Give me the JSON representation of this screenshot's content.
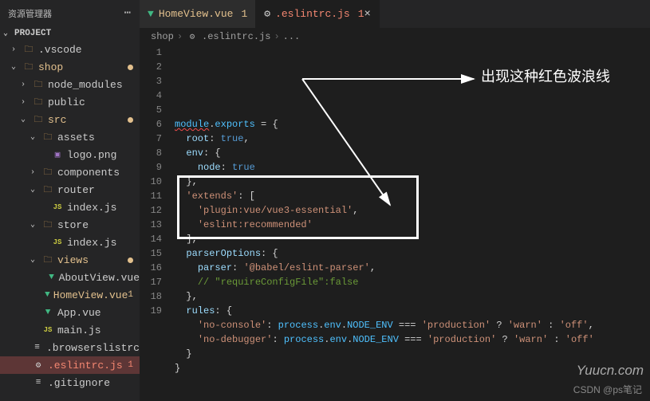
{
  "sidebar": {
    "title": "资源管理器",
    "project": "PROJECT",
    "items": [
      {
        "label": ".vscode",
        "type": "folder",
        "indent": 1,
        "chev": "›"
      },
      {
        "label": "shop",
        "type": "folder",
        "indent": 1,
        "chev": "⌄",
        "modified": true,
        "dot": true
      },
      {
        "label": "node_modules",
        "type": "folder",
        "indent": 2,
        "chev": "›"
      },
      {
        "label": "public",
        "type": "folder",
        "indent": 2,
        "chev": "›"
      },
      {
        "label": "src",
        "type": "folder",
        "indent": 2,
        "chev": "⌄",
        "modified": true,
        "dot": true
      },
      {
        "label": "assets",
        "type": "folder",
        "indent": 3,
        "chev": "⌄"
      },
      {
        "label": "logo.png",
        "type": "img",
        "indent": 4
      },
      {
        "label": "components",
        "type": "folder",
        "indent": 3,
        "chev": "›"
      },
      {
        "label": "router",
        "type": "folder",
        "indent": 3,
        "chev": "⌄"
      },
      {
        "label": "index.js",
        "type": "js",
        "indent": 4
      },
      {
        "label": "store",
        "type": "folder",
        "indent": 3,
        "chev": "⌄"
      },
      {
        "label": "index.js",
        "type": "js",
        "indent": 4
      },
      {
        "label": "views",
        "type": "folder",
        "indent": 3,
        "chev": "⌄",
        "modified": true,
        "dot": true
      },
      {
        "label": "AboutView.vue",
        "type": "vue",
        "indent": 4
      },
      {
        "label": "HomeView.vue",
        "type": "vue",
        "indent": 4,
        "modified": true,
        "badge": "1"
      },
      {
        "label": "App.vue",
        "type": "vue",
        "indent": 3
      },
      {
        "label": "main.js",
        "type": "js",
        "indent": 3
      },
      {
        "label": ".browserslistrc",
        "type": "file",
        "indent": 2
      },
      {
        "label": ".eslintrc.js",
        "type": "gear",
        "indent": 2,
        "highlighted": true,
        "red": true,
        "badge": "1"
      },
      {
        "label": ".gitignore",
        "type": "file",
        "indent": 2
      }
    ]
  },
  "tabs": [
    {
      "icon": "vue",
      "label": "HomeView.vue",
      "badge": "1",
      "modified": true
    },
    {
      "icon": "gear",
      "label": ".eslintrc.js",
      "badge": "1",
      "red": true,
      "active": true
    }
  ],
  "breadcrumbs": [
    "shop",
    ".eslintrc.js",
    "..."
  ],
  "annotation": "出现这种红色波浪线",
  "watermark_side": "Yuucn.com",
  "watermark_bottom": "CSDN @ps笔记",
  "code": {
    "lines": [
      [
        {
          "t": "module",
          "c": "tk-obj squiggle"
        },
        {
          "t": ".",
          "c": "tk-pun"
        },
        {
          "t": "exports",
          "c": "tk-obj"
        },
        {
          "t": " = {",
          "c": "tk-pun"
        }
      ],
      [
        {
          "t": "  ",
          "c": ""
        },
        {
          "t": "root",
          "c": "tk-prop"
        },
        {
          "t": ": ",
          "c": "tk-pun"
        },
        {
          "t": "true",
          "c": "tk-bool"
        },
        {
          "t": ",",
          "c": "tk-pun"
        }
      ],
      [
        {
          "t": "  ",
          "c": ""
        },
        {
          "t": "env",
          "c": "tk-prop"
        },
        {
          "t": ": {",
          "c": "tk-pun"
        }
      ],
      [
        {
          "t": "    ",
          "c": ""
        },
        {
          "t": "node",
          "c": "tk-prop"
        },
        {
          "t": ": ",
          "c": "tk-pun"
        },
        {
          "t": "true",
          "c": "tk-bool"
        }
      ],
      [
        {
          "t": "  },",
          "c": "tk-pun"
        }
      ],
      [
        {
          "t": "  ",
          "c": ""
        },
        {
          "t": "'extends'",
          "c": "tk-str"
        },
        {
          "t": ": [",
          "c": "tk-pun"
        }
      ],
      [
        {
          "t": "    ",
          "c": ""
        },
        {
          "t": "'plugin:vue/vue3-essential'",
          "c": "tk-str"
        },
        {
          "t": ",",
          "c": "tk-pun"
        }
      ],
      [
        {
          "t": "    ",
          "c": ""
        },
        {
          "t": "'eslint:recommended'",
          "c": "tk-str"
        }
      ],
      [
        {
          "t": "  ],",
          "c": "tk-pun"
        }
      ],
      [
        {
          "t": "  ",
          "c": ""
        },
        {
          "t": "parserOptions",
          "c": "tk-prop"
        },
        {
          "t": ": {",
          "c": "tk-pun"
        }
      ],
      [
        {
          "t": "    ",
          "c": ""
        },
        {
          "t": "parser",
          "c": "tk-prop"
        },
        {
          "t": ": ",
          "c": "tk-pun"
        },
        {
          "t": "'@babel/eslint-parser'",
          "c": "tk-str"
        },
        {
          "t": ",",
          "c": "tk-pun"
        }
      ],
      [
        {
          "t": "    ",
          "c": ""
        },
        {
          "t": "// \"requireConfigFile\":false",
          "c": "tk-cmt"
        }
      ],
      [
        {
          "t": "  },",
          "c": "tk-pun"
        }
      ],
      [
        {
          "t": "  ",
          "c": ""
        },
        {
          "t": "rules",
          "c": "tk-prop"
        },
        {
          "t": ": {",
          "c": "tk-pun"
        }
      ],
      [
        {
          "t": "    ",
          "c": ""
        },
        {
          "t": "'no-console'",
          "c": "tk-str"
        },
        {
          "t": ": ",
          "c": "tk-pun"
        },
        {
          "t": "process",
          "c": "tk-obj"
        },
        {
          "t": ".",
          "c": "tk-pun"
        },
        {
          "t": "env",
          "c": "tk-obj"
        },
        {
          "t": ".",
          "c": "tk-pun"
        },
        {
          "t": "NODE_ENV",
          "c": "tk-obj"
        },
        {
          "t": " === ",
          "c": "tk-pun"
        },
        {
          "t": "'production'",
          "c": "tk-str"
        },
        {
          "t": " ? ",
          "c": "tk-pun"
        },
        {
          "t": "'warn'",
          "c": "tk-str"
        },
        {
          "t": " : ",
          "c": "tk-pun"
        },
        {
          "t": "'off'",
          "c": "tk-str"
        },
        {
          "t": ",",
          "c": "tk-pun"
        }
      ],
      [
        {
          "t": "    ",
          "c": ""
        },
        {
          "t": "'no-debugger'",
          "c": "tk-str"
        },
        {
          "t": ": ",
          "c": "tk-pun"
        },
        {
          "t": "process",
          "c": "tk-obj"
        },
        {
          "t": ".",
          "c": "tk-pun"
        },
        {
          "t": "env",
          "c": "tk-obj"
        },
        {
          "t": ".",
          "c": "tk-pun"
        },
        {
          "t": "NODE_ENV",
          "c": "tk-obj"
        },
        {
          "t": " === ",
          "c": "tk-pun"
        },
        {
          "t": "'production'",
          "c": "tk-str"
        },
        {
          "t": " ? ",
          "c": "tk-pun"
        },
        {
          "t": "'warn'",
          "c": "tk-str"
        },
        {
          "t": " : ",
          "c": "tk-pun"
        },
        {
          "t": "'off'",
          "c": "tk-str"
        }
      ],
      [
        {
          "t": "  }",
          "c": "tk-pun"
        }
      ],
      [
        {
          "t": "}",
          "c": "tk-pun"
        }
      ],
      []
    ]
  }
}
